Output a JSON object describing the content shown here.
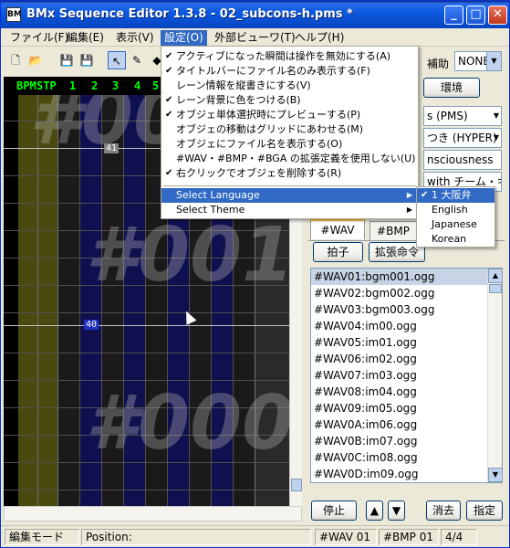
{
  "window": {
    "title": "BMx Sequence Editor 1.3.8 - 02_subcons-h.pms *",
    "icon_label": "BM",
    "minimize_glyph": "_",
    "maximize_glyph": "□",
    "close_glyph": "✕"
  },
  "menubar": {
    "items": [
      {
        "label": "ファイル(F)"
      },
      {
        "label": "編集(E)"
      },
      {
        "label": "表示(V)"
      },
      {
        "label": "設定(O)"
      },
      {
        "label": "外部ビューワ(T)"
      },
      {
        "label": "ヘルプ(H)"
      }
    ]
  },
  "toolbar": {
    "icons": [
      "new-file-icon",
      "open-folder-icon",
      "save-icon",
      "save-as-icon",
      "select-cursor-icon",
      "pencil-icon",
      "write-icon"
    ],
    "hojo_label": "補助",
    "hojo_value": "NONE"
  },
  "editor": {
    "lanes": [
      "BPM",
      "STP",
      "1",
      "2",
      "3",
      "4",
      "5"
    ],
    "watermark_top": "#001",
    "watermark_mid": "#001",
    "watermark_bottom": "#000",
    "measure_top": "41",
    "measure_mid": "40"
  },
  "settings_menu": {
    "items": [
      {
        "label": "アクティブになった瞬間は操作を無効にする(A)",
        "checked": true
      },
      {
        "label": "タイトルバーにファイル名のみ表示する(F)",
        "checked": true
      },
      {
        "label": "レーン情報を縦書きにする(V)",
        "checked": false
      },
      {
        "label": "レーン背景に色をつける(B)",
        "checked": true
      },
      {
        "label": "オブジェ単体選択時にプレビューする(P)",
        "checked": true
      },
      {
        "label": "オブジェの移動はグリッドにあわせる(M)",
        "checked": false
      },
      {
        "label": "オブジェにファイル名を表示する(O)",
        "checked": false
      },
      {
        "label": "#WAV・#BMP・#BGA の拡張定義を使用しない(U)",
        "checked": false
      },
      {
        "label": "右クリックでオブジェを削除する(R)",
        "checked": true
      }
    ],
    "select_language": "Select Language",
    "select_theme": "Select Theme",
    "check_glyph": "✔",
    "submenu_arrow": "▶"
  },
  "language_submenu": {
    "items": [
      {
        "label": "1 大阪弁",
        "checked": true
      },
      {
        "label": "English",
        "checked": false
      },
      {
        "label": "Japanese",
        "checked": false
      },
      {
        "label": "Korean",
        "checked": false
      }
    ]
  },
  "right_panel": {
    "env_button": "環境",
    "mode_field": "s (PMS)",
    "difficulty_field": "つき (HYPER)",
    "title_field": "nsciousness",
    "artist_field": "with チーム・キ:",
    "tabs": [
      {
        "label": "#WAV",
        "active": true
      },
      {
        "label": "#BMP",
        "active": false
      }
    ],
    "beat_button": "拍子",
    "ext_command_button": "拡張命令",
    "wav_list": [
      "#WAV01:bgm001.ogg",
      "#WAV02:bgm002.ogg",
      "#WAV03:bgm003.ogg",
      "#WAV04:im00.ogg",
      "#WAV05:im01.ogg",
      "#WAV06:im02.ogg",
      "#WAV07:im03.ogg",
      "#WAV08:im04.ogg",
      "#WAV09:im05.ogg",
      "#WAV0A:im06.ogg",
      "#WAV0B:im07.ogg",
      "#WAV0C:im08.ogg",
      "#WAV0D:im09.ogg"
    ],
    "stop_button": "停止",
    "up_glyph": "▲",
    "down_glyph": "▼",
    "erase_button": "消去",
    "assign_button": "指定"
  },
  "statusbar": {
    "mode": "編集モード",
    "position": "Position:",
    "wav": "#WAV 01",
    "bmp": "#BMP 01",
    "beat": "4/4"
  },
  "colors": {
    "titlebar": "#0A4FD0",
    "menu_highlight": "#316AC5",
    "lane_text": "#00FF00",
    "bpm_lane": "#404010",
    "blue_lane": "#101060",
    "gray_lane": "#202020"
  }
}
